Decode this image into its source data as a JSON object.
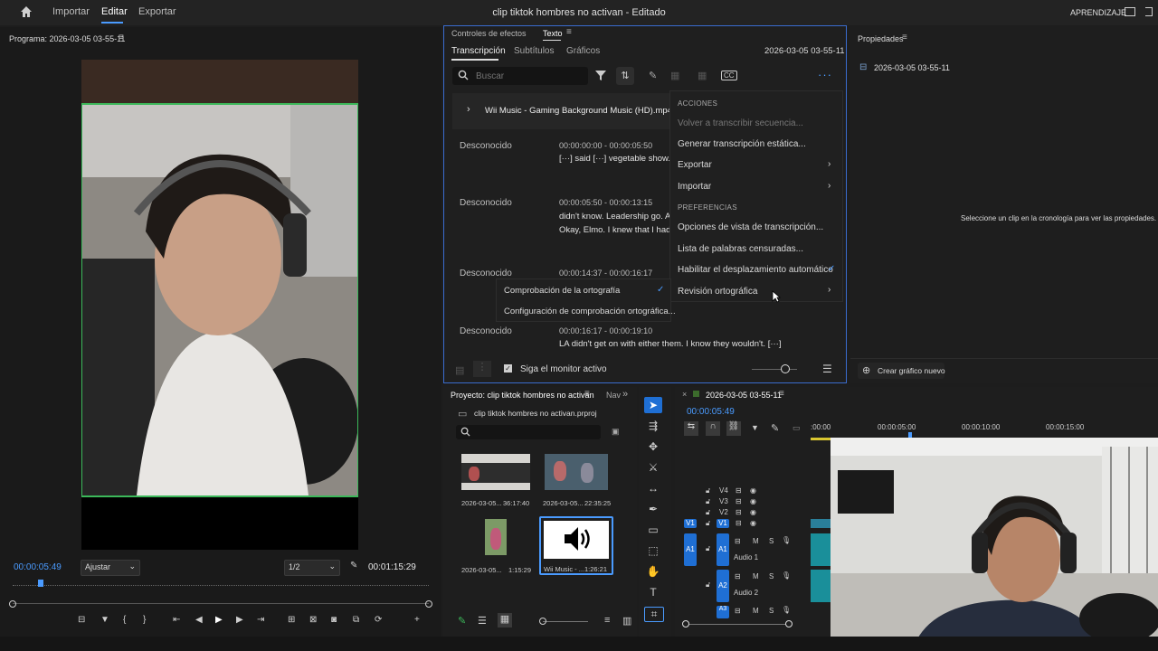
{
  "topbar": {
    "menus": [
      "Importar",
      "Editar",
      "Exportar"
    ],
    "title": "clip tiktok hombres no activan - Editado",
    "learn": "APRENDIZAJE"
  },
  "program": {
    "title": "Programa: 2026-03-05 03-55-11",
    "timecode_current": "00:00:05:49",
    "fit": "Ajustar",
    "quality": "1/2",
    "timecode_total": "00:01:15:29"
  },
  "textpanel": {
    "tab_effects": "Controles de efectos",
    "tab_text": "Texto",
    "subtabs": [
      "Transcripción",
      "Subtítulos",
      "Gráficos"
    ],
    "sequence_name": "2026-03-05 03-55-11",
    "search_placeholder": "Buscar",
    "clip_name": "Wii Music - Gaming Background Music (HD).mp4 n",
    "entries": [
      {
        "speaker": "Desconocido",
        "time": "00:00:00:00 - 00:00:05:50",
        "lines": [
          "[···] said [···] vegetable show. C"
        ]
      },
      {
        "speaker": "Desconocido",
        "time": "00:00:05:50 - 00:00:13:15",
        "lines": [
          "didn't know. Leadership go. An",
          "Okay, Elmo. I knew that I had t"
        ]
      },
      {
        "speaker": "Desconocido",
        "time": "00:00:14:37 - 00:00:16:17",
        "lines": []
      },
      {
        "speaker": "Desconocido",
        "time": "00:00:16:17 - 00:00:19:10",
        "lines": [
          "LA didn't get on with either them. I know they wouldn't. [···]"
        ]
      }
    ],
    "follow_monitor": "Siga el monitor activo"
  },
  "actions_menu": {
    "header_actions": "ACCIONES",
    "items_a": [
      {
        "label": "Volver a transcribir secuencia...",
        "disabled": true
      },
      {
        "label": "Generar transcripción estática...",
        "disabled": false
      },
      {
        "label": "Exportar",
        "submenu": true
      },
      {
        "label": "Importar",
        "submenu": true
      }
    ],
    "header_prefs": "PREFERENCIAS",
    "items_b": [
      {
        "label": "Opciones de vista de transcripción..."
      },
      {
        "label": "Lista de palabras censuradas..."
      },
      {
        "label": "Habilitar el desplazamiento automático",
        "checked": true
      },
      {
        "label": "Revisión ortográfica",
        "submenu": true
      }
    ]
  },
  "spell_submenu": {
    "items": [
      {
        "label": "Comprobación de la ortografía",
        "checked": true
      },
      {
        "label": "Configuración de comprobación ortográfica..."
      }
    ]
  },
  "properties": {
    "title": "Propiedades",
    "sequence": "2026-03-05 03-55-11",
    "empty_msg": "Seleccione un clip en la cronología para ver las propiedades.",
    "new_graphic": "Crear gráfico nuevo"
  },
  "project": {
    "title": "Proyecto: clip tiktok hombres no activan",
    "nav": "Nav",
    "file": "clip tiktok hombres no activan.prproj",
    "items": [
      {
        "name": "2026-03-05...",
        "dur": "36:17:40"
      },
      {
        "name": "2026-03-05...",
        "dur": "22:35:25"
      },
      {
        "name": "2026-03-05...",
        "dur": "1:15:29"
      },
      {
        "name": "Wii Music - ...",
        "dur": "1:26:21"
      }
    ]
  },
  "timeline": {
    "sequence": "2026-03-05 03-55-11",
    "timecode": "00:00:05:49",
    "ruler": [
      ":00:00",
      "00:00:05:00",
      "00:00:10:00",
      "00:00:15:00"
    ],
    "video_tracks": [
      "V4",
      "V3",
      "V2",
      "V1"
    ],
    "audio_tracks": [
      {
        "id": "A1",
        "name": "Audio 1"
      },
      {
        "id": "A2",
        "name": "Audio 2"
      },
      {
        "id": "A3",
        "name": ""
      }
    ],
    "track_button_m": "M",
    "track_button_s": "S"
  },
  "colors": {
    "accent": "#4a9bff",
    "panel_border": "#3a6ccf"
  }
}
